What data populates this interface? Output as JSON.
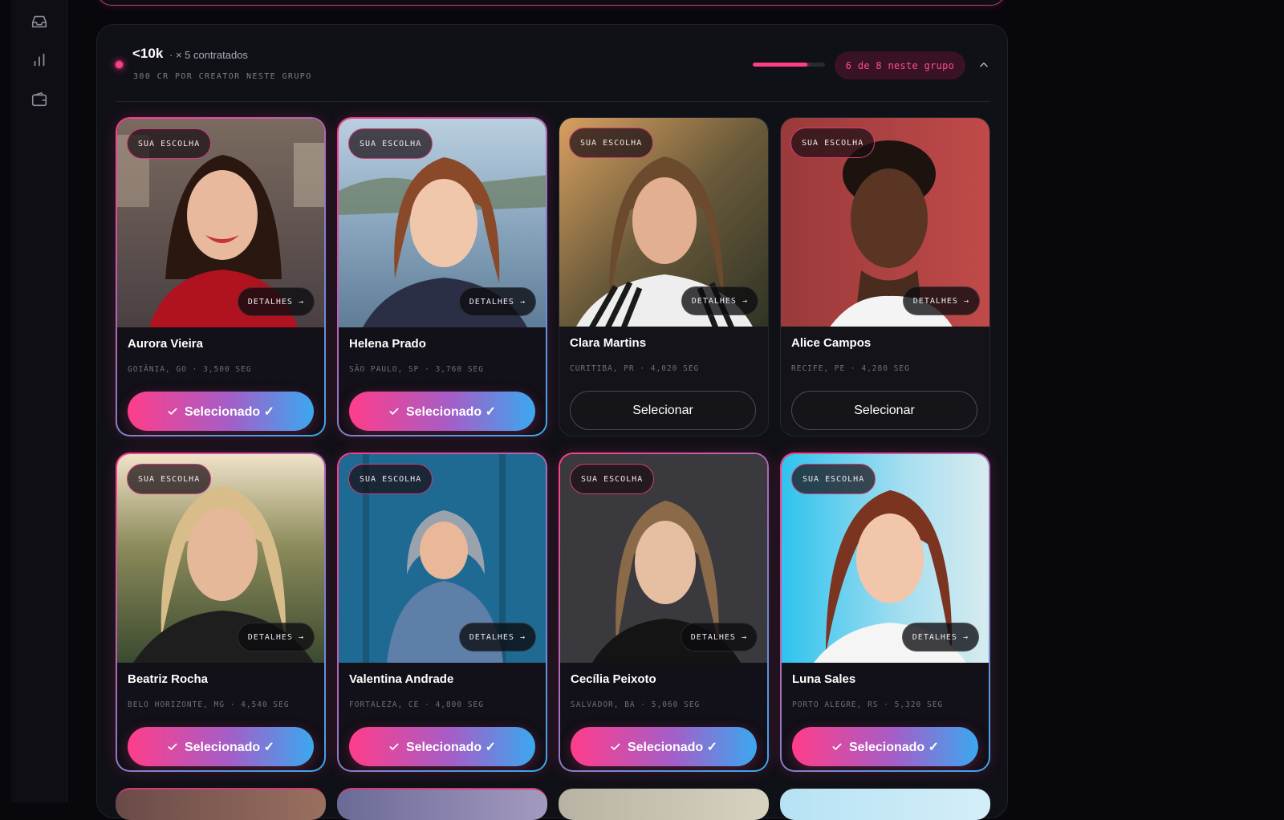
{
  "sidebar": {
    "icons": [
      "inbox-icon",
      "bar-chart-icon",
      "wallet-icon"
    ]
  },
  "group": {
    "title": "<10k",
    "count": "· × 5 contratados",
    "subtitle": "300 CR POR CREATOR NESTE GRUPO",
    "progress": 0.75,
    "pill": "6 de 8 neste grupo"
  },
  "colors": {
    "accent_pink": "#ff3d8a",
    "accent_blue": "#3aa8f0",
    "panel": "#101017"
  },
  "cards": [
    {
      "name": "Aurora Vieira",
      "meta": "GOIÂNIA, GO · 3,500 SEG",
      "badge": "SUA ESCOLHA",
      "details": "DETALHES →",
      "action": "Selecionado ✓",
      "selected": true
    },
    {
      "name": "Helena Prado",
      "meta": "SÃO PAULO, SP · 3,760 SEG",
      "badge": "SUA ESCOLHA",
      "details": "DETALHES →",
      "action": "Selecionado ✓",
      "selected": true
    },
    {
      "name": "Clara Martins",
      "meta": "CURITIBA, PR · 4,020 SEG",
      "badge": "SUA ESCOLHA",
      "details": "DETALHES →",
      "action": "Selecionar",
      "selected": false
    },
    {
      "name": "Alice Campos",
      "meta": "RECIFE, PE · 4,280 SEG",
      "badge": "SUA ESCOLHA",
      "details": "DETALHES →",
      "action": "Selecionar",
      "selected": false
    },
    {
      "name": "Beatriz Rocha",
      "meta": "BELO HORIZONTE, MG · 4,540 SEG",
      "badge": "SUA ESCOLHA",
      "details": "DETALHES →",
      "action": "Selecionado ✓",
      "selected": true
    },
    {
      "name": "Valentina Andrade",
      "meta": "FORTALEZA, CE · 4,800 SEG",
      "badge": "SUA ESCOLHA",
      "details": "DETALHES →",
      "action": "Selecionado ✓",
      "selected": true
    },
    {
      "name": "Cecília Peixoto",
      "meta": "SALVADOR, BA · 5,060 SEG",
      "badge": "SUA ESCOLHA",
      "details": "DETALHES →",
      "action": "Selecionado ✓",
      "selected": true
    },
    {
      "name": "Luna Sales",
      "meta": "PORTO ALEGRE, RS · 5,320 SEG",
      "badge": "SUA ESCOLHA",
      "details": "DETALHES →",
      "action": "Selecionado ✓",
      "selected": true
    }
  ]
}
